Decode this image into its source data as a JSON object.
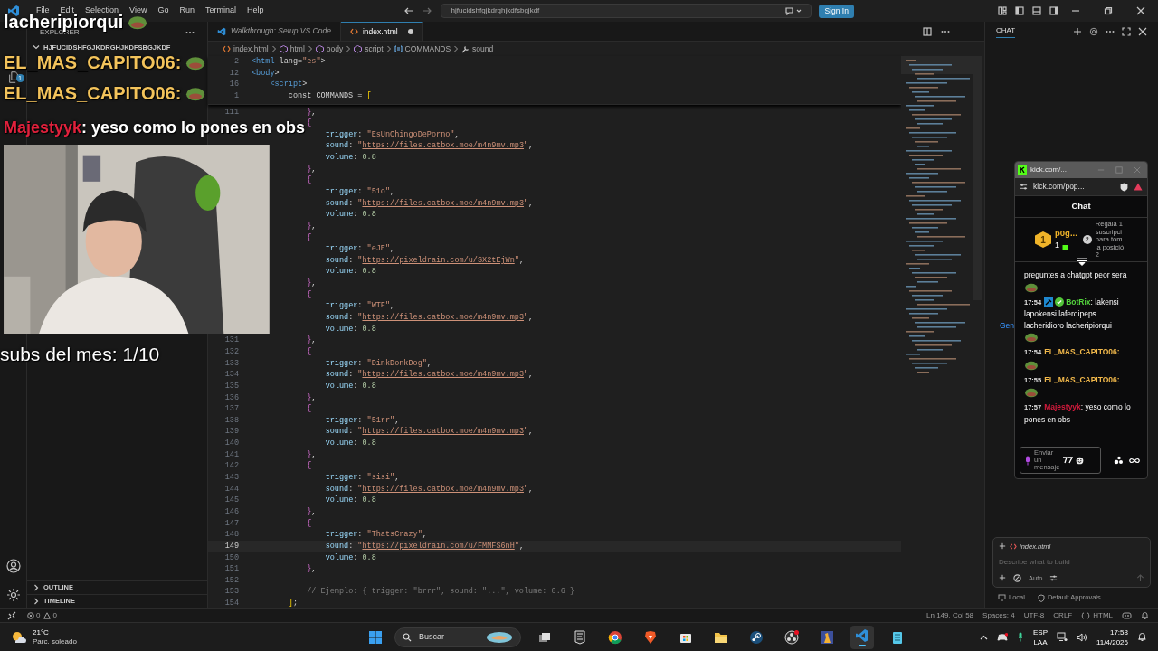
{
  "menu": [
    "File",
    "Edit",
    "Selection",
    "View",
    "Go",
    "Run",
    "Terminal",
    "Help"
  ],
  "command_center": "hjfucidshfgjkdrghjkdfsbgjkdf",
  "sign_in": "Sign In",
  "activity_badge": "1",
  "explorer": {
    "title": "EXPLORER",
    "folder": "HJFUCIDSHFGJKDRGHJKDFSBGJKDF",
    "sections": [
      {
        "label": "OUTLINE",
        "expanded": false
      },
      {
        "label": "TIMELINE",
        "expanded": false
      }
    ]
  },
  "tabs": [
    {
      "label": "Walkthrough: Setup VS Code",
      "kind": "walkthrough",
      "selected": false,
      "modified": false
    },
    {
      "label": "index.html",
      "kind": "html",
      "selected": true,
      "modified": true
    }
  ],
  "breadcrumb": [
    {
      "label": "index.html",
      "kind": "file"
    },
    {
      "label": "html",
      "kind": "element"
    },
    {
      "label": "body",
      "kind": "element"
    },
    {
      "label": "script",
      "kind": "element"
    },
    {
      "label": "COMMANDS",
      "kind": "variable"
    },
    {
      "label": "sound",
      "kind": "property"
    }
  ],
  "sticky": [
    {
      "num": "2",
      "code": "<html lang=\"es\">"
    },
    {
      "num": "12",
      "code": "<body>"
    },
    {
      "num": "16",
      "code": "    <script>"
    },
    {
      "num": "1",
      "code": "        const COMMANDS = ["
    }
  ],
  "lines": [
    {
      "num": "111",
      "code": "            },"
    },
    {
      "code": "            {"
    },
    {
      "code": "                trigger: \"EsUnChingoDePorno\","
    },
    {
      "code": "                sound: \"https://files.catbox.moe/m4n9mv.mp3\","
    },
    {
      "code": "                volume: 0.8"
    },
    {
      "code": "            },"
    },
    {
      "code": "            {"
    },
    {
      "code": "                trigger: \"51o\","
    },
    {
      "code": "                sound: \"https://files.catbox.moe/m4n9mv.mp3\","
    },
    {
      "code": "                volume: 0.8"
    },
    {
      "code": "            },"
    },
    {
      "code": "            {"
    },
    {
      "code": "                trigger: \"eJE\","
    },
    {
      "code": "                sound: \"https://pixeldrain.com/u/SX2tEjWn\","
    },
    {
      "code": "                volume: 0.8"
    },
    {
      "code": "            },"
    },
    {
      "code": "            {"
    },
    {
      "code": "                trigger: \"WTF\","
    },
    {
      "code": "                sound: \"https://files.catbox.moe/m4n9mv.mp3\","
    },
    {
      "code": "                volume: 0.8"
    },
    {
      "num": "131",
      "code": "            },"
    },
    {
      "num": "132",
      "code": "            {"
    },
    {
      "num": "133",
      "code": "                trigger: \"DinkDonkDog\","
    },
    {
      "num": "134",
      "code": "                sound: \"https://files.catbox.moe/m4n9mv.mp3\","
    },
    {
      "num": "135",
      "code": "                volume: 0.8"
    },
    {
      "num": "136",
      "code": "            },"
    },
    {
      "num": "137",
      "code": "            {"
    },
    {
      "num": "138",
      "code": "                trigger: \"51rr\","
    },
    {
      "num": "139",
      "code": "                sound: \"https://files.catbox.moe/m4n9mv.mp3\","
    },
    {
      "num": "140",
      "code": "                volume: 0.8"
    },
    {
      "num": "141",
      "code": "            },"
    },
    {
      "num": "142",
      "code": "            {"
    },
    {
      "num": "143",
      "code": "                trigger: \"sisi\","
    },
    {
      "num": "144",
      "code": "                sound: \"https://files.catbox.moe/m4n9mv.mp3\","
    },
    {
      "num": "145",
      "code": "                volume: 0.8"
    },
    {
      "num": "146",
      "code": "            },",
      "current": false
    },
    {
      "num": "147",
      "code": "            {",
      "current": false
    },
    {
      "num": "148",
      "code": "                trigger: \"ThatsCrazy\",",
      "current": false
    },
    {
      "num": "149",
      "code": "                sound: \"https://pixeldrain.com/u/FMMFS6nH\",",
      "current": true
    },
    {
      "num": "150",
      "code": "                volume: 0.8",
      "current": false
    },
    {
      "num": "151",
      "code": "            },",
      "current": false
    },
    {
      "num": "152",
      "current": false
    },
    {
      "num": "153",
      "code": "            // Ejemplo: { trigger: \"brrr\", sound: \"...\", volume: 0.6 }",
      "current": false
    },
    {
      "num": "154",
      "code": "        ];",
      "current": false
    }
  ],
  "chat_panel": {
    "tab": "CHAT",
    "peek": "Gen",
    "attachment": "index.html",
    "placeholder": "Describe what to build",
    "mode": "Auto",
    "location": "Local",
    "approvals": "Default Approvals"
  },
  "status_bar": {
    "errors": "0",
    "warnings": "0",
    "position": "Ln 149, Col 58",
    "spaces": "Spaces: 4",
    "encoding": "UTF-8",
    "eol": "CRLF",
    "language": "HTML"
  },
  "stream_overlay": {
    "chat": [
      {
        "text": "lacheripiorqui",
        "color": "#ffffff",
        "emote": true
      },
      {
        "user": "EL_MAS_CAPITO06:",
        "color": "#f3c35b",
        "emote": true
      },
      {
        "user": "EL_MAS_CAPITO06:",
        "color": "#f3c35b",
        "emote": true
      },
      {
        "user": "Majestyyk",
        "text": ": yeso como lo pones en obs",
        "color": "#e0213c",
        "emote": false
      }
    ],
    "subs": "subs del mes: 1/10"
  },
  "kick_popup": {
    "title": "kick.com/...",
    "url": "kick.com/pop...",
    "heading": "Chat",
    "leader": {
      "rank": "1",
      "name": "p0g...",
      "count": "1",
      "next_rank": "2",
      "prompt": "Regala 1\nsuscripci\npara tom\nla posició\n2"
    },
    "messages": [
      {
        "text": "preguntes a chatgpt peor sera",
        "emote": true,
        "badges": false
      },
      {
        "time": "17:54",
        "user": "BotRix",
        "color": "#53d43d",
        "badges": true,
        "text": ": lakensi lapokensi laferdipeps lacheridioro lacheripiorqui",
        "emote": true
      },
      {
        "time": "17:54",
        "user": "EL_MAS_CAPITO06:",
        "color": "#f2b94b",
        "badges": false,
        "emote": true
      },
      {
        "time": "17:55",
        "user": "EL_MAS_CAPITO06:",
        "color": "#f2b94b",
        "badges": false,
        "emote": true
      },
      {
        "time": "17:57",
        "user": "Majestyyk",
        "color": "#d11a3c",
        "badges": false,
        "text": ": yeso como lo pones en obs",
        "emote": false
      }
    ],
    "input_placeholder": "Enviar un mensaje"
  },
  "taskbar": {
    "temperature": "21°C",
    "weather": "Parc. soleado",
    "search": "Buscar",
    "lang": "ESP",
    "layout": "LAA",
    "time": "17:58",
    "date": "11/4/2026"
  }
}
